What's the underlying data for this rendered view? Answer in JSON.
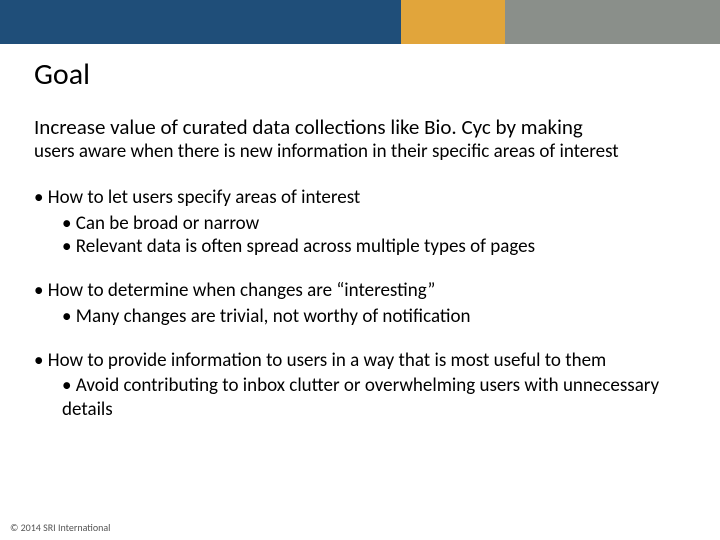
{
  "banner": {
    "colors": {
      "blue": "#1f4e79",
      "gold": "#e1a53b",
      "gray": "#8a8f8a"
    }
  },
  "title": "Goal",
  "lead": "Increase value of curated data collections like Bio. Cyc by making",
  "lead_sub": "users aware when there is new information in their specific areas of interest",
  "bullets": [
    {
      "text": "How to let users specify areas of interest",
      "sub": [
        "Can be broad or narrow",
        "Relevant data is often spread across multiple types of pages"
      ]
    },
    {
      "text": "How to determine when changes are “interesting”",
      "sub": [
        "Many changes are trivial, not worthy of notification"
      ]
    },
    {
      "text": "How to provide information to users in a way that is most useful to them",
      "sub": [
        "Avoid contributing to inbox clutter or overwhelming users with unnecessary details"
      ]
    }
  ],
  "footer": "© 2014 SRI International"
}
